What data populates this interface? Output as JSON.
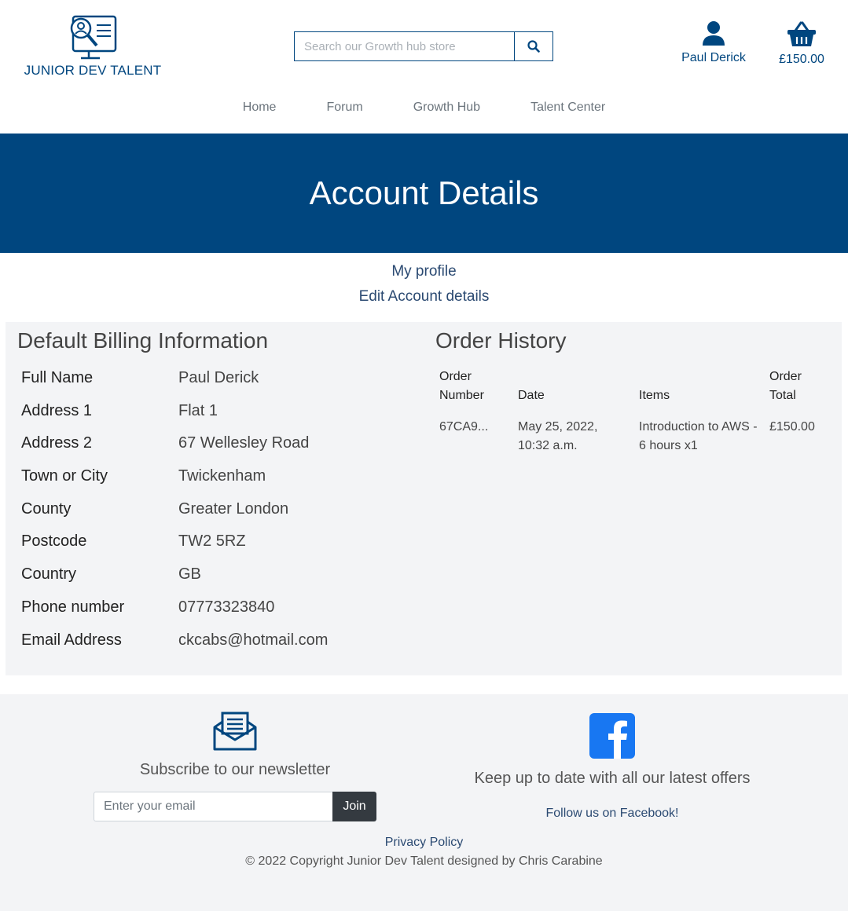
{
  "header": {
    "logo_text": "JUNIOR DEV TALENT",
    "search_placeholder": "Search our Growth hub store",
    "account_label": "Paul Derick",
    "basket_total": "£150.00"
  },
  "nav": [
    "Home",
    "Forum",
    "Growth Hub",
    "Talent Center"
  ],
  "banner_title": "Account Details",
  "sublinks": {
    "profile": "My profile",
    "edit": "Edit Account details"
  },
  "billing": {
    "title": "Default Billing Information",
    "rows": [
      {
        "label": "Full Name",
        "value": "Paul Derick"
      },
      {
        "label": "Address 1",
        "value": "Flat 1"
      },
      {
        "label": "Address 2",
        "value": "67 Wellesley Road"
      },
      {
        "label": "Town or City",
        "value": "Twickenham"
      },
      {
        "label": "County",
        "value": "Greater London"
      },
      {
        "label": "Postcode",
        "value": "TW2 5RZ"
      },
      {
        "label": "Country",
        "value": "GB"
      },
      {
        "label": "Phone number",
        "value": "07773323840"
      },
      {
        "label": "Email Address",
        "value": "ckcabs@hotmail.com"
      }
    ]
  },
  "orders": {
    "title": "Order History",
    "headers": {
      "number": "Order Number",
      "date": "Date",
      "items": "Items",
      "total": "Order Total"
    },
    "rows": [
      {
        "number": "67CA9...",
        "date": "May 25, 2022, 10:32 a.m.",
        "items": "Introduction to AWS - 6 hours x1",
        "total": "£150.00"
      }
    ]
  },
  "footer": {
    "newsletter_title": "Subscribe to our newsletter",
    "email_placeholder": "Enter your email",
    "join_label": "Join",
    "social_title": "Keep up to date with all our latest offers",
    "facebook_link": "Follow us on Facebook!",
    "privacy": "Privacy Policy",
    "copyright": "© 2022 Copyright Junior Dev Talent designed by Chris Carabine"
  },
  "colors": {
    "brand": "#00467f",
    "panel": "#f3f4f6",
    "link": "#2d7fd3",
    "facebook": "#1877f2"
  }
}
